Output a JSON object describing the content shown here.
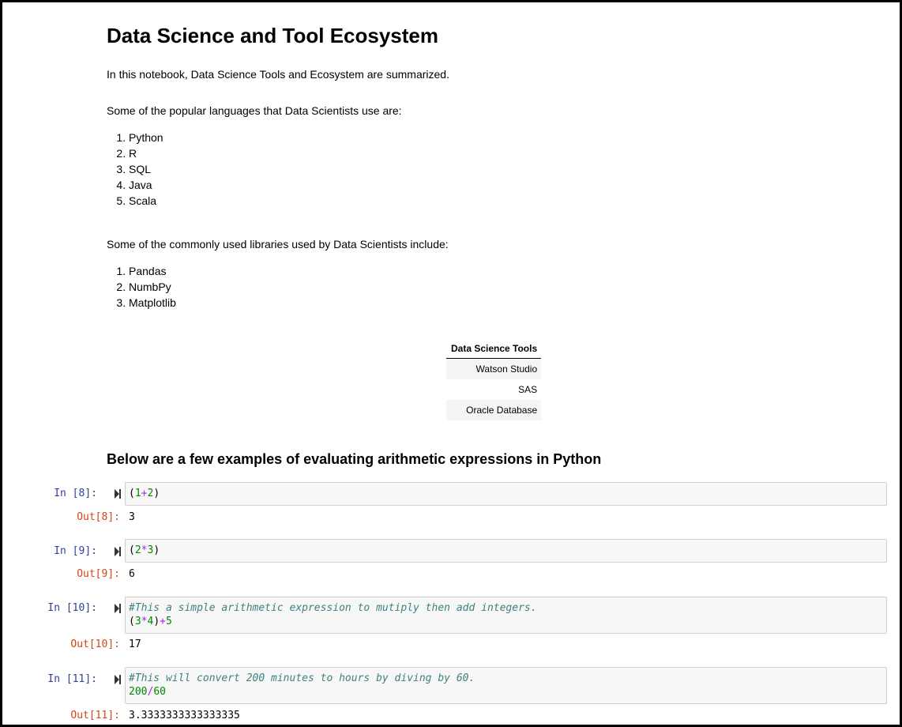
{
  "notebook": {
    "title": "Data Science and Tool Ecosystem",
    "intro": "In this notebook, Data Science Tools and Ecosystem are summarized.",
    "languages_heading": "Some of the popular languages that Data Scientists use are:",
    "languages": [
      "Python",
      "R",
      "SQL",
      "Java",
      "Scala"
    ],
    "libraries_heading": "Some of the commonly used libraries used by Data Scientists include:",
    "libraries": [
      "Pandas",
      "NumbPy",
      "Matplotlib"
    ],
    "tools_table": {
      "header": "Data Science Tools",
      "rows": [
        "Watson Studio",
        "SAS",
        "Oracle Database"
      ]
    },
    "examples_heading": "Below are a few examples of evaluating arithmetic expressions in Python"
  },
  "cells": [
    {
      "in_prompt": "In [8]:",
      "out_prompt": "Out[8]:",
      "output": "3",
      "code": {
        "p1": "(",
        "n1": "1",
        "op": "+",
        "n2": "2",
        "p2": ")"
      }
    },
    {
      "in_prompt": "In [9]:",
      "out_prompt": "Out[9]:",
      "output": "6",
      "code": {
        "p1": "(",
        "n1": "2",
        "op": "*",
        "n2": "3",
        "p2": ")"
      }
    },
    {
      "in_prompt": "In [10]:",
      "out_prompt": "Out[10]:",
      "output": "17",
      "comment": "#This a simple arithmetic expression to mutiply then add integers.",
      "code": {
        "p1": "(",
        "n1": "3",
        "op": "*",
        "n2": "4",
        "p2": ")",
        "op2": "+",
        "n3": "5"
      }
    },
    {
      "in_prompt": "In [11]:",
      "out_prompt": "Out[11]:",
      "output": "3.3333333333333335",
      "comment": "#This will convert 200 minutes to hours by diving by 60.",
      "code": {
        "n1": "200",
        "op": "/",
        "n2": "60"
      }
    }
  ],
  "colors": {
    "in_prompt": "#303f9f",
    "out_prompt": "#d84315",
    "comment": "#408080",
    "number": "#008800",
    "operator": "#aa22ff"
  },
  "icons": {
    "run": "step-forward-icon"
  }
}
